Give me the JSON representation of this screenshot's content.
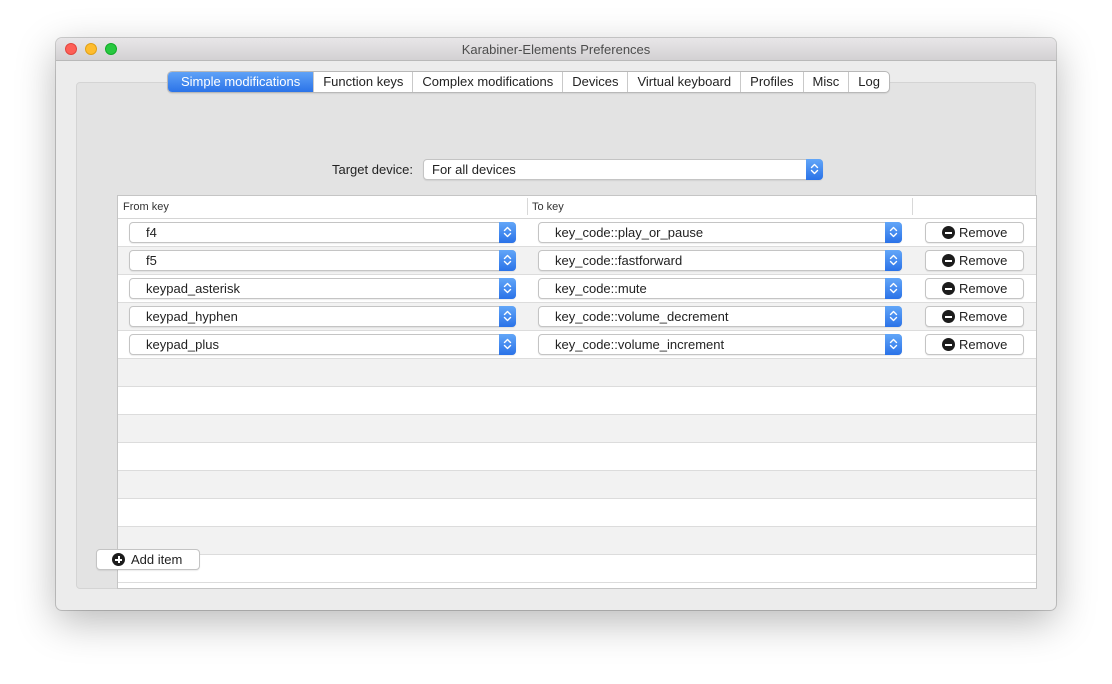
{
  "window": {
    "title": "Karabiner-Elements Preferences"
  },
  "tabs": [
    {
      "label": "Simple modifications",
      "active": true
    },
    {
      "label": "Function keys",
      "active": false
    },
    {
      "label": "Complex modifications",
      "active": false
    },
    {
      "label": "Devices",
      "active": false
    },
    {
      "label": "Virtual keyboard",
      "active": false
    },
    {
      "label": "Profiles",
      "active": false
    },
    {
      "label": "Misc",
      "active": false
    },
    {
      "label": "Log",
      "active": false
    }
  ],
  "target_device": {
    "label": "Target device:",
    "value": "For all devices"
  },
  "table": {
    "columns": {
      "from": "From key",
      "to": "To key"
    },
    "rows": [
      {
        "from": "f4",
        "to": "key_code::play_or_pause",
        "remove_label": "Remove"
      },
      {
        "from": "f5",
        "to": "key_code::fastforward",
        "remove_label": "Remove"
      },
      {
        "from": "keypad_asterisk",
        "to": "key_code::mute",
        "remove_label": "Remove"
      },
      {
        "from": "keypad_hyphen",
        "to": "key_code::volume_decrement",
        "remove_label": "Remove"
      },
      {
        "from": "keypad_plus",
        "to": "key_code::volume_increment",
        "remove_label": "Remove"
      }
    ]
  },
  "add_item_label": "Add item",
  "icons": {
    "remove": "minus-circle-icon",
    "add": "plus-circle-icon",
    "popup": "chevron-up-down-icon"
  },
  "colors": {
    "accent": "#2b73e8",
    "window_bg": "#ececec"
  }
}
